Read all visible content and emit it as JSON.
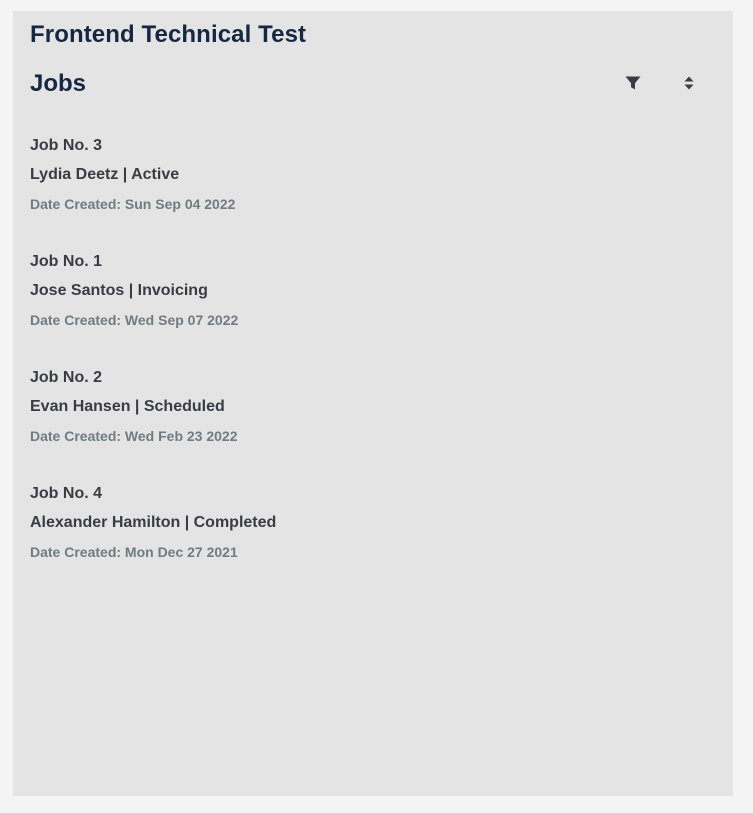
{
  "app": {
    "title": "Frontend Technical Test"
  },
  "section": {
    "title": "Jobs"
  },
  "toolbar": {
    "filter_icon": "filter-icon",
    "sort_icon": "sort-icon"
  },
  "jobs": [
    {
      "number": "Job No. 3",
      "summary": "Lydia Deetz | Active",
      "date": "Date Created: Sun Sep 04 2022"
    },
    {
      "number": "Job No. 1",
      "summary": "Jose Santos | Invoicing",
      "date": "Date Created: Wed Sep 07 2022"
    },
    {
      "number": "Job No. 2",
      "summary": "Evan Hansen | Scheduled",
      "date": "Date Created: Wed Feb 23 2022"
    },
    {
      "number": "Job No. 4",
      "summary": "Alexander Hamilton | Completed",
      "date": "Date Created: Mon Dec 27 2021"
    }
  ],
  "colors": {
    "page_background": "#f4f4f4",
    "panel_background": "#e4e4e4",
    "heading": "#152842",
    "body_text": "#3a3c44",
    "muted_text": "#6f7c80",
    "icon": "#3a3c44"
  }
}
